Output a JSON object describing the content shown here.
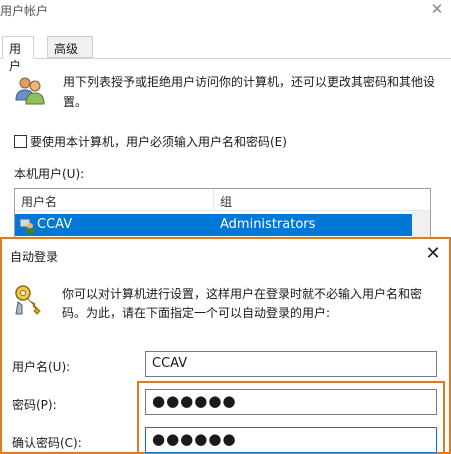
{
  "main_window": {
    "title": "用户帐户",
    "close_glyph": "✕",
    "tabs": [
      {
        "label": "用户",
        "active": true
      },
      {
        "label": "高级",
        "active": false
      }
    ],
    "description": "用下列表授予或拒绝用户访问你的计算机，还可以更改其密码和其他设置。",
    "require_login_checkbox": {
      "label": "要使用本计算机，用户必须输入用户名和密码(E)",
      "checked": false
    },
    "local_users_label": "本机用户(U):",
    "table": {
      "columns": [
        "用户名",
        "组"
      ],
      "rows": [
        {
          "user": "CCAV",
          "group": "Administrators",
          "selected": true
        }
      ]
    },
    "icons": {
      "users": "users-icon",
      "row": "user-row-icon"
    }
  },
  "auto_login_dialog": {
    "title": "自动登录",
    "close_glyph": "✕",
    "description": "你可以对计算机进行设置，这样用户在登录时就不必输入用户名和密码。为此，请在下面指定一个可以自动登录的用户:",
    "fields": {
      "username": {
        "label": "用户名(U):",
        "value": "CCAV"
      },
      "password": {
        "label": "密码(P):",
        "value": "●●●●●●"
      },
      "confirm": {
        "label": "确认密码(C):",
        "value": "●●●●●●"
      }
    },
    "icons": {
      "key": "key-icon"
    }
  },
  "colors": {
    "selection": "#0078d7",
    "highlight_border": "#e07b24"
  }
}
